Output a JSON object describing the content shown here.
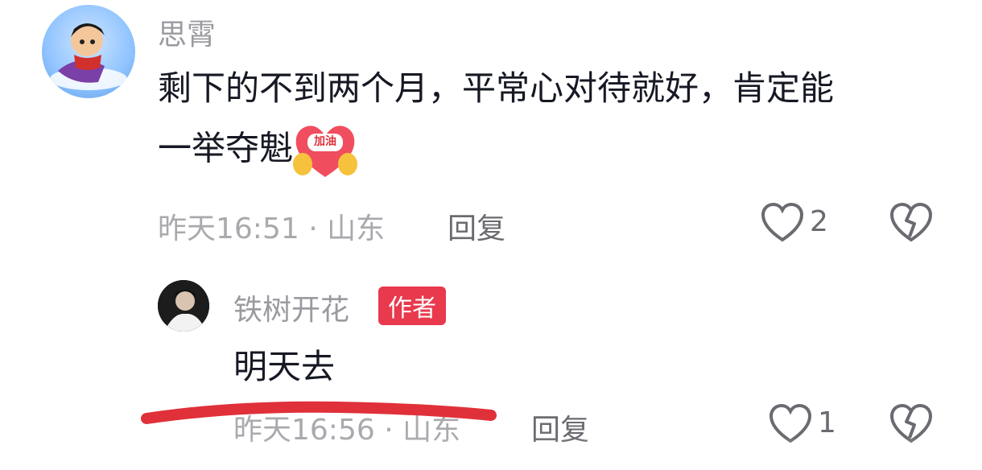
{
  "comment": {
    "author": "思霄",
    "text_line1": "剩下的不到两个月，平常心对待就好，肯定能",
    "text_line2": "一举夺魁",
    "emoji_label": "加油",
    "time_location": "昨天16:51 · 山东",
    "reply_label": "回复",
    "like_count": "2"
  },
  "reply": {
    "author": "铁树开花",
    "author_badge": "作者",
    "text": "明天去",
    "time_location": "昨天16:56 · 山东",
    "reply_label": "回复",
    "like_count": "1"
  },
  "colors": {
    "badge": "#e8394d",
    "underline": "#e0303a",
    "emoji_heart": "#f04e5e",
    "emoji_hands": "#f6c23b"
  }
}
